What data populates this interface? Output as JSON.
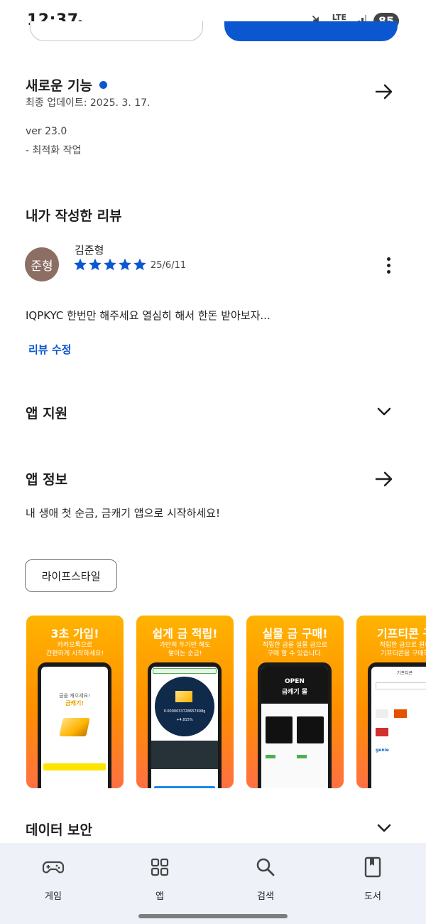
{
  "status_bar": {
    "time": "12:37",
    "network": "LTE",
    "battery": "85"
  },
  "whats_new": {
    "title": "새로운 기능",
    "updated": "최종 업데이트: 2025. 3. 17.",
    "version": "ver 23.0",
    "note": "- 최적화 작업"
  },
  "my_review": {
    "title": "내가 작성한 리뷰",
    "avatar_text": "준형",
    "reviewer": "김준형",
    "rating": 5,
    "date": "25/6/11",
    "text": "IQPKYC 한번만 해주세요 열심히 해서 한돈 받아보자...",
    "edit_link": "리뷰 수정"
  },
  "app_support": {
    "title": "앱 지원"
  },
  "app_info": {
    "title": "앱 정보",
    "description": "내 생애 첫 순금, 금캐기 앱으로 시작하세요!",
    "category_chip": "라이프스타일"
  },
  "screenshots": [
    {
      "title": "3초 가입!",
      "subtitle": "카카오톡으로\n간편하게 시작하세요!",
      "screen_text_1": "금을 캐으세요!",
      "screen_text_2": "금캐기!"
    },
    {
      "title": "쉽게 금 적립!",
      "subtitle": "가만히 두기만 해도\n쌓이는 순금!",
      "screen_text_1": "0.0000033728657408g",
      "screen_text_2": "+4.815%"
    },
    {
      "title": "실물 금 구매!",
      "subtitle": "적립한 금을 실물 금으로\n구매 할 수 있습니다.",
      "screen_text_1": "OPEN",
      "screen_text_2": "금캐기 몰"
    },
    {
      "title": "기프티콘 구",
      "subtitle": "적립한 금으로 원하\n기프티콘을 구매하",
      "screen_text_1": "기프티콘",
      "screen_text_2": "genie"
    }
  ],
  "data_safety": {
    "title": "데이터 보안"
  },
  "bottom_nav": [
    {
      "label": "게임",
      "icon": "gamepad-icon"
    },
    {
      "label": "앱",
      "icon": "apps-grid-icon"
    },
    {
      "label": "검색",
      "icon": "search-icon"
    },
    {
      "label": "도서",
      "icon": "book-icon"
    }
  ],
  "colors": {
    "accent": "#0b57d0",
    "avatar": "#8d6e63",
    "nav_bg": "#eef2f8",
    "shot_gradient_top": "#ffb300",
    "shot_gradient_bottom": "#ff7043"
  }
}
